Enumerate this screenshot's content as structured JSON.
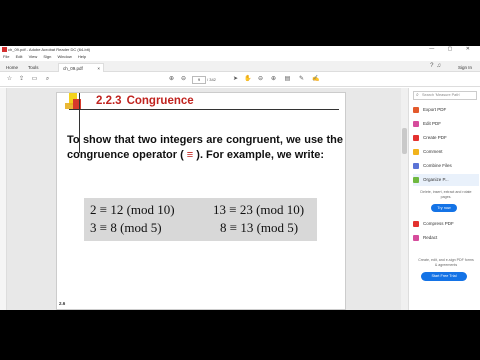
{
  "window": {
    "title": "ch_09.pdf - Adobe Acrobat Reader DC (64-bit)",
    "controls": "— ▢ ✕"
  },
  "menu": [
    "File",
    "Edit",
    "View",
    "Sign",
    "Window",
    "Help"
  ],
  "tabs": {
    "home": "Home",
    "tools": "Tools",
    "document": "ch_09.pdf",
    "close": "×"
  },
  "toolbar": {
    "page_current": "9",
    "page_total": "/ 342",
    "signin": "Sign In"
  },
  "document": {
    "section_number": "2.2.3",
    "section_title": "Congruence",
    "para_before": "To show that two integers are congruent, we use the congruence operator ( ",
    "operator": "≡",
    "para_after": " ). For example, we write:",
    "examples": [
      "2 ≡ 12 (mod 10)",
      "13 ≡ 23 (mod 10)",
      "3 ≡ 8 (mod 5)",
      "8 ≡ 13 (mod 5)"
    ],
    "page_number": "2.6"
  },
  "right_panel": {
    "search_placeholder": "Search 'Measure Path'",
    "tools": [
      {
        "label": "Export PDF",
        "color": "#e35a2c"
      },
      {
        "label": "Edit PDF",
        "color": "#d64c9c"
      },
      {
        "label": "Create PDF",
        "color": "#e3312f"
      },
      {
        "label": "Comment",
        "color": "#f1b31c"
      },
      {
        "label": "Combine Files",
        "color": "#5b73d6"
      },
      {
        "label": "Organize P...",
        "color": "#6fb83f"
      }
    ],
    "promo_text": "Delete, insert, extract and rotate pages.",
    "try_label": "Try now",
    "extra_tools": [
      {
        "label": "Compress PDF",
        "color": "#e3312f"
      },
      {
        "label": "Redact",
        "color": "#d64c9c"
      }
    ],
    "footer_text": "Create, edit, and e-sign PDF forms & agreements",
    "free_trial_label": "Start Free Trial"
  }
}
